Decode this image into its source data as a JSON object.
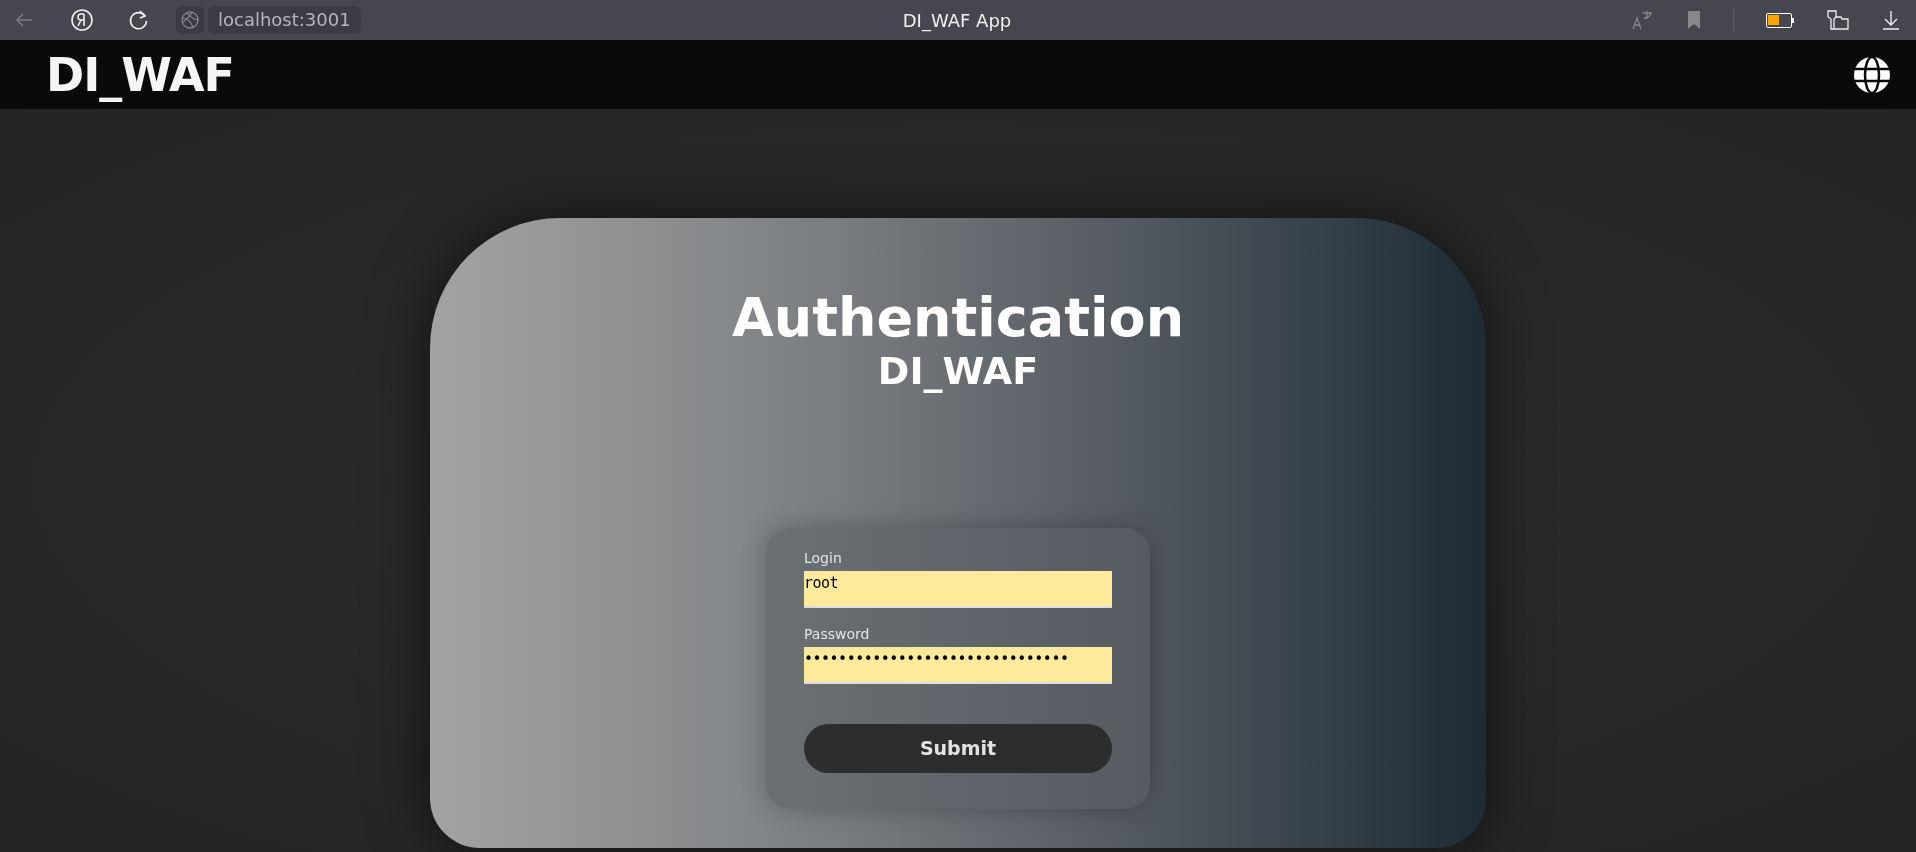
{
  "browser": {
    "address": "localhost:3001",
    "title": "DI_WAF App"
  },
  "header": {
    "logo": "DI_WAF"
  },
  "card": {
    "title": "Authentication",
    "subtitle": "DI_WAF"
  },
  "form": {
    "fields": [
      {
        "label": "Login",
        "value": "root"
      },
      {
        "label": "Password",
        "value": "•••••••••••••••••••••••••••••••"
      }
    ],
    "submit": "Submit"
  }
}
